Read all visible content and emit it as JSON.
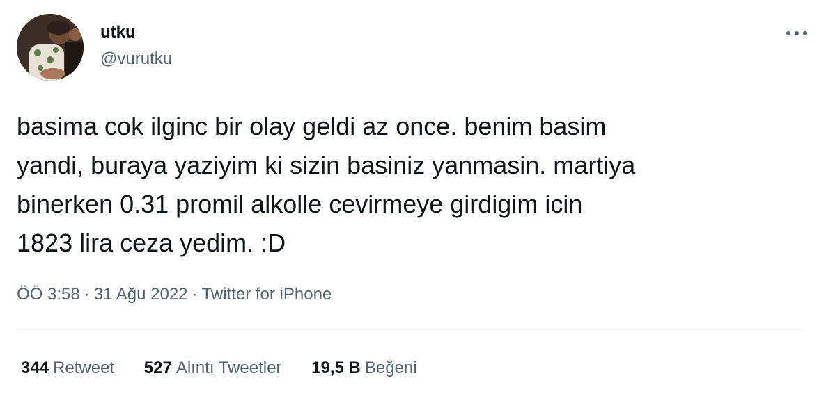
{
  "user": {
    "display_name": "utku",
    "handle": "@vurutku",
    "avatar_icon": "profile-photo"
  },
  "more_icon": "ellipsis-icon",
  "tweet": {
    "text": "basima cok ilginc bir olay geldi az once. benim basim\nyandi, buraya yaziyim ki sizin basiniz yanmasin. martiya\nbinerken 0.31 promil alkolle cevirmeye girdigim icin\n1823 lira ceza yedim. :D",
    "time": "ÖÖ 3:58",
    "date": "31 Ağu 2022",
    "source": "Twitter for iPhone",
    "separator": "·"
  },
  "stats": [
    {
      "count": "344",
      "label": "Retweet"
    },
    {
      "count": "527",
      "label": "Alıntı Tweetler"
    },
    {
      "count": "19,5 B",
      "label": "Beğeni"
    }
  ],
  "colors": {
    "text": "#0f1419",
    "secondary": "#536471",
    "divider": "#e6ecf0"
  }
}
